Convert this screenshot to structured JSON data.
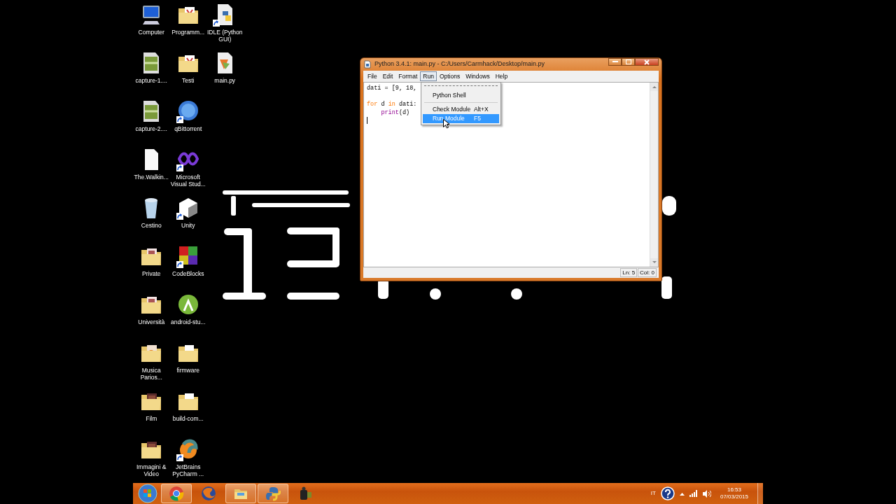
{
  "desktop": {
    "icon_rows": [
      [
        {
          "label": "Computer",
          "kind": "computer",
          "shortcut": false
        },
        {
          "label": "Programm...",
          "kind": "folder-pdf",
          "shortcut": false
        },
        {
          "label": "IDLE (Python GUI)",
          "kind": "python-file",
          "shortcut": true
        }
      ],
      [
        {
          "label": "capture-1....",
          "kind": "video-file",
          "shortcut": false
        },
        {
          "label": "Testi",
          "kind": "folder-pdf",
          "shortcut": false
        },
        {
          "label": "main.py",
          "kind": "script-file",
          "shortcut": false
        }
      ],
      [
        {
          "label": "capture-2....",
          "kind": "video-file",
          "shortcut": false
        },
        {
          "label": "qBittorrent",
          "kind": "torrent",
          "shortcut": true
        }
      ],
      [
        {
          "label": "The.Walkin...",
          "kind": "blank-file",
          "shortcut": false
        },
        {
          "label": "Microsoft Visual Stud...",
          "kind": "infinity",
          "shortcut": true
        }
      ],
      [
        {
          "label": "Cestino",
          "kind": "recycle-bin",
          "shortcut": false
        },
        {
          "label": "Unity",
          "kind": "cube",
          "shortcut": true
        }
      ],
      [
        {
          "label": "Private",
          "kind": "folder-photo",
          "shortcut": false
        },
        {
          "label": "CodeBlocks",
          "kind": "blocks",
          "shortcut": true
        }
      ],
      [
        {
          "label": "Università",
          "kind": "folder-photo",
          "shortcut": false
        },
        {
          "label": "android-stu...",
          "kind": "android",
          "shortcut": false
        }
      ],
      [
        {
          "label": "Musica Parios...",
          "kind": "folder-music",
          "shortcut": false
        },
        {
          "label": "firmware",
          "kind": "folder-plain",
          "shortcut": false
        }
      ],
      [
        {
          "label": "Film",
          "kind": "folder-film",
          "shortcut": false
        },
        {
          "label": "build-com...",
          "kind": "folder-plain",
          "shortcut": false
        }
      ],
      [
        {
          "label": "Immagini & Video",
          "kind": "folder-film",
          "shortcut": false
        },
        {
          "label": "JetBrains PyCharm ...",
          "kind": "pycharm",
          "shortcut": true
        }
      ]
    ]
  },
  "window": {
    "title": "Python 3.4.1: main.py - C:/Users/Carmhack/Desktop/main.py",
    "menu": [
      {
        "label": "File",
        "selected": false
      },
      {
        "label": "Edit",
        "selected": false
      },
      {
        "label": "Format",
        "selected": false
      },
      {
        "label": "Run",
        "selected": true
      },
      {
        "label": "Options",
        "selected": false
      },
      {
        "label": "Windows",
        "selected": false
      },
      {
        "label": "Help",
        "selected": false
      }
    ],
    "code_lines": [
      {
        "kind": "code",
        "tokens": [
          {
            "text": "dati = [9, 18,",
            "kind": "plain"
          }
        ]
      },
      {
        "kind": "blank"
      },
      {
        "kind": "code",
        "tokens": [
          {
            "text": "for",
            "kind": "keyword"
          },
          {
            "text": " d ",
            "kind": "plain"
          },
          {
            "text": "in",
            "kind": "keyword"
          },
          {
            "text": " dati:",
            "kind": "plain"
          }
        ]
      },
      {
        "kind": "code",
        "indented": true,
        "tokens": [
          {
            "text": "print",
            "kind": "builtin"
          },
          {
            "text": "(d)",
            "kind": "plain"
          }
        ]
      },
      {
        "kind": "caret"
      }
    ],
    "run_menu": [
      {
        "kind": "tearoff"
      },
      {
        "kind": "item",
        "label": "Python Shell",
        "selected": false
      },
      {
        "kind": "separator"
      },
      {
        "kind": "item",
        "label": "Check Module",
        "shortcut": "Alt+X",
        "selected": false
      },
      {
        "kind": "item",
        "label": "Run Module",
        "shortcut": "F5",
        "selected": true
      }
    ],
    "status": {
      "line": "Ln: 5",
      "column": "Col: 0"
    }
  },
  "taskbar": {
    "buttons": [
      {
        "kind": "browser",
        "open": true
      },
      {
        "kind": "fox",
        "open": false
      },
      {
        "kind": "folder",
        "open": true
      },
      {
        "kind": "python",
        "open": true
      },
      {
        "kind": "camcorder",
        "open": false
      }
    ],
    "language": "IT",
    "time": "16:53",
    "date": "07/03/2015"
  }
}
